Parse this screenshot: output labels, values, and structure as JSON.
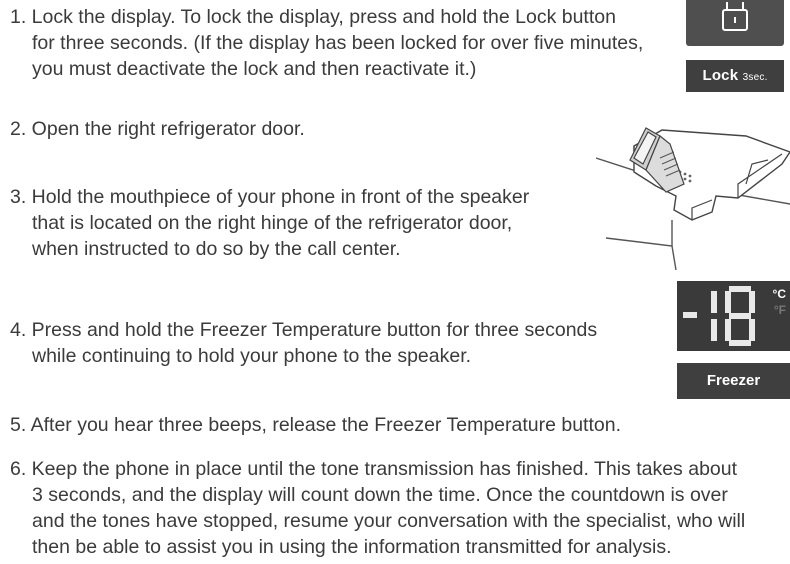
{
  "steps": [
    {
      "lines": [
        "1. Lock the display. To lock the display, press and hold the Lock button",
        "for three seconds. (If the display has been locked for over five minutes,",
        "you must deactivate the lock and then reactivate it.)"
      ]
    },
    {
      "lines": [
        "2. Open the right refrigerator door."
      ]
    },
    {
      "lines": [
        "3. Hold the mouthpiece of your phone in front of the speaker",
        "that is located on the right hinge of the refrigerator door,",
        "when instructed to do so by the call center."
      ]
    },
    {
      "lines": [
        "4. Press and hold the Freezer Temperature button for three seconds",
        "while continuing to hold your phone to the speaker."
      ]
    },
    {
      "lines": [
        "5. After you hear three beeps, release the Freezer Temperature button."
      ]
    },
    {
      "lines": [
        "6. Keep the phone in place until the tone transmission has finished. This takes about",
        "3 seconds, and the display will count down the time. Once the countdown is over",
        "and the tones have stopped, resume your conversation with the specialist, who will",
        "then be able to assist you in using the information transmitted for analysis."
      ]
    }
  ],
  "lock_panel": {
    "button_label": "Lock",
    "button_sub": "3sec.",
    "icon": "lock-icon"
  },
  "freezer_panel": {
    "display_value": "-18",
    "unit_c": "°C",
    "unit_f": "°F",
    "button_label": "Freezer"
  },
  "hinge_illustration": {
    "icon": "phone-at-hinge-illustration"
  },
  "colors": {
    "text": "#3b3b3b",
    "panel_dark": "#3f3f3f",
    "display_bg": "#3a3a3a",
    "segment_lit": "#e8e8e8"
  }
}
